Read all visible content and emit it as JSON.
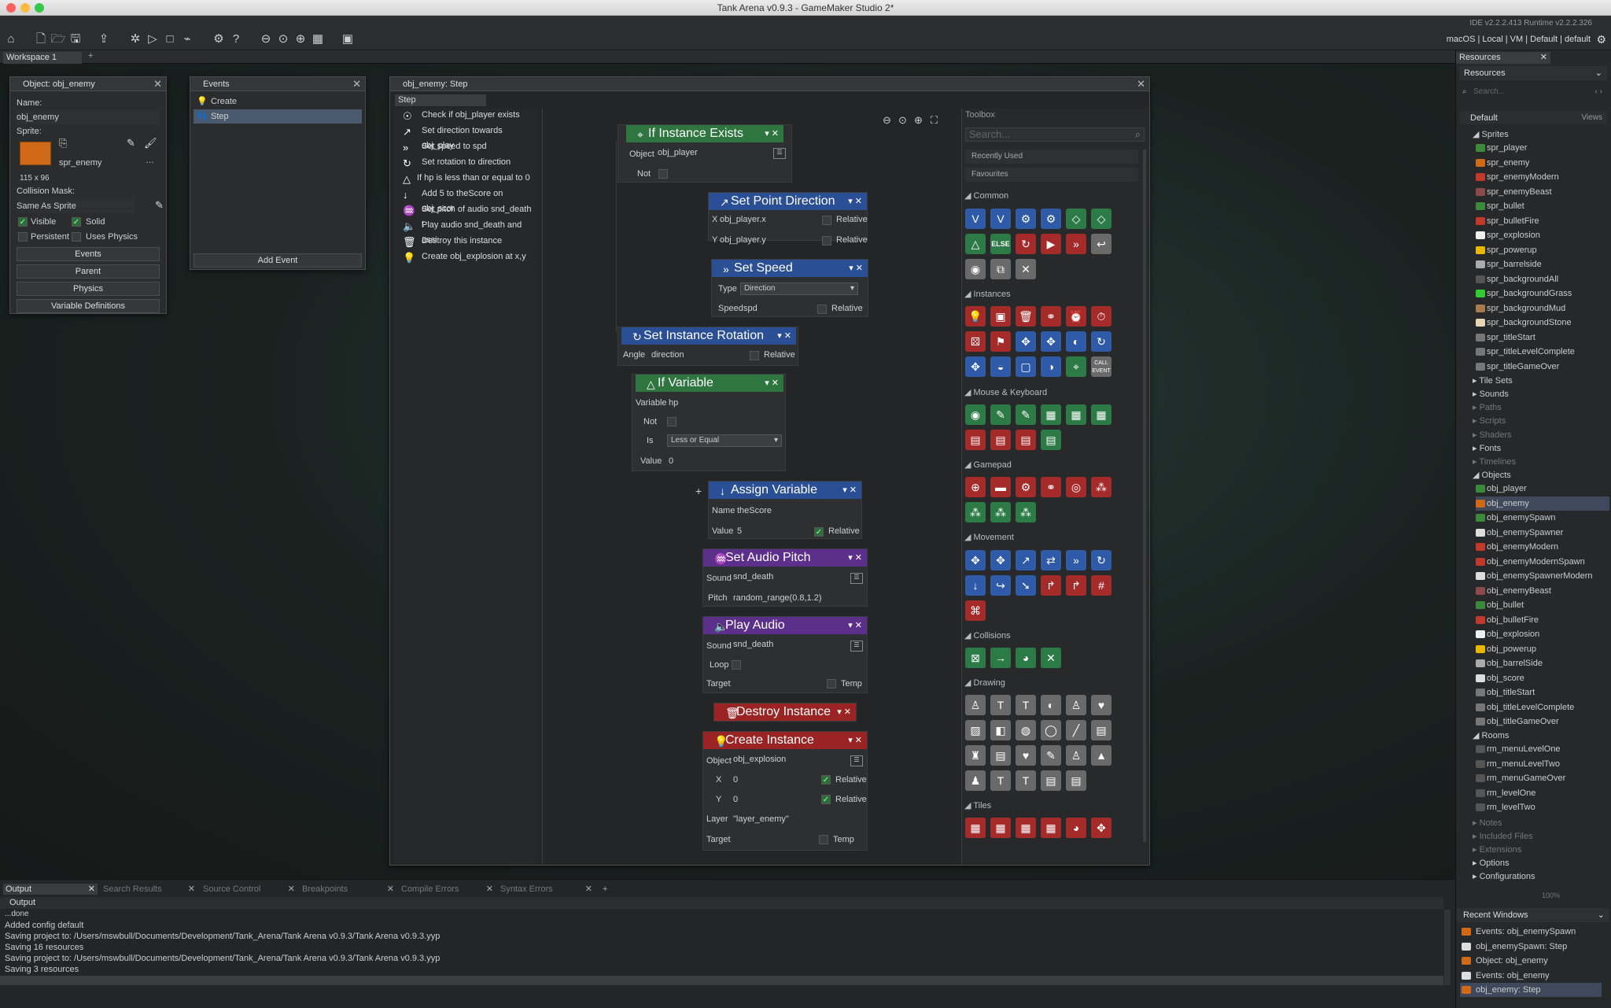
{
  "window_title": "Tank Arena v0.9.3 - GameMaker Studio 2*",
  "ide_version": "IDE v2.2.2.413  Runtime v2.2.2.326",
  "target_info": "macOS | Local | VM | Default | default",
  "workspace_tab": "Workspace 1",
  "workspace_add": "+",
  "object_panel": {
    "title": "Object: obj_enemy",
    "name_label": "Name:",
    "name_value": "obj_enemy",
    "sprite_label": "Sprite:",
    "sprite_name": "spr_enemy",
    "sprite_size": "115 x 96",
    "collision_label": "Collision Mask:",
    "collision_value": "Same As Sprite",
    "visible": "Visible",
    "solid": "Solid",
    "persistent": "Persistent",
    "uses_physics": "Uses Physics",
    "events_btn": "Events",
    "parent_btn": "Parent",
    "physics_btn": "Physics",
    "vardefs_btn": "Variable Definitions"
  },
  "events_panel": {
    "title": "Events",
    "items": [
      "Create",
      "Step"
    ],
    "add_event": "Add Event"
  },
  "editor": {
    "title": "obj_enemy: Step",
    "tab": "Step",
    "step_list": [
      "Check if obj_player exists",
      "Set direction towards obj_play",
      "Set speed to spd",
      "Set rotation to direction",
      "If hp is less than or equal to 0",
      "Add 5 to theScore on obj_scor",
      "Set pitch of audio snd_death t",
      "Play audio snd_death and assi",
      "Destroy this instance",
      "Create obj_explosion at x,y"
    ]
  },
  "blocks": {
    "if_instance_exists": {
      "title": "If Instance Exists",
      "object_label": "Object",
      "object_value": "obj_player",
      "not": "Not"
    },
    "set_point_direction": {
      "title": "Set Point Direction",
      "x_label": "X",
      "x_value": "obj_player.x",
      "y_label": "Y",
      "y_value": "obj_player.y",
      "relative": "Relative"
    },
    "set_speed": {
      "title": "Set Speed",
      "type_label": "Type",
      "type_value": "Direction",
      "speed_label": "Speed",
      "speed_value": "spd",
      "relative": "Relative"
    },
    "set_instance_rotation": {
      "title": "Set Instance Rotation",
      "angle_label": "Angle",
      "angle_value": "direction",
      "relative": "Relative"
    },
    "if_variable": {
      "title": "If Variable",
      "variable_label": "Variable",
      "variable_value": "hp",
      "not": "Not",
      "is_label": "Is",
      "is_value": "Less or Equal",
      "value_label": "Value",
      "value_value": "0"
    },
    "assign_variable": {
      "title": "Assign Variable",
      "name_label": "Name",
      "name_value": "theScore",
      "value_label": "Value",
      "value_value": "5",
      "relative": "Relative"
    },
    "set_audio_pitch": {
      "title": "Set Audio Pitch",
      "sound_label": "Sound",
      "sound_value": "snd_death",
      "pitch_label": "Pitch",
      "pitch_value": "random_range(0.8,1.2)"
    },
    "play_audio": {
      "title": "Play Audio",
      "sound_label": "Sound",
      "sound_value": "snd_death",
      "loop": "Loop",
      "target_label": "Target",
      "temp": "Temp"
    },
    "destroy_instance": {
      "title": "Destroy Instance"
    },
    "create_instance": {
      "title": "Create Instance",
      "object_label": "Object",
      "object_value": "obj_explosion",
      "x_label": "X",
      "x_value": "0",
      "y_label": "Y",
      "y_value": "0",
      "relative": "Relative",
      "layer_label": "Layer",
      "layer_value": "\"layer_enemy\"",
      "target_label": "Target",
      "temp": "Temp"
    }
  },
  "toolbox": {
    "title": "Toolbox",
    "search_placeholder": "Search...",
    "recently_used": "Recently Used",
    "favourites": "Favourites",
    "sections": [
      "Common",
      "Instances",
      "Mouse & Keyboard",
      "Gamepad",
      "Movement",
      "Collisions",
      "Drawing",
      "Tiles"
    ],
    "else_label": "ELSE"
  },
  "resources": {
    "title": "Resources",
    "dropdown": "Resources",
    "search_placeholder": "Search...",
    "group": "Default",
    "views": "Views",
    "categories": {
      "sprites": "Sprites",
      "tilesets": "Tile Sets",
      "sounds": "Sounds",
      "paths": "Paths",
      "scripts": "Scripts",
      "shaders": "Shaders",
      "fonts": "Fonts",
      "timelines": "Timelines",
      "objects": "Objects",
      "rooms": "Rooms",
      "notes": "Notes",
      "included": "Included Files",
      "extensions": "Extensions",
      "options": "Options",
      "configurations": "Configurations"
    },
    "sprites": [
      "spr_player",
      "spr_enemy",
      "spr_enemyModern",
      "spr_enemyBeast",
      "spr_bullet",
      "spr_bulletFire",
      "spr_explosion",
      "spr_powerup",
      "spr_barrelside",
      "spr_backgroundAll",
      "spr_backgroundGrass",
      "spr_backgroundMud",
      "spr_backgroundStone",
      "spr_titleStart",
      "spr_titleLevelComplete",
      "spr_titleGameOver"
    ],
    "objects": [
      "obj_player",
      "obj_enemy",
      "obj_enemySpawn",
      "obj_enemySpawner",
      "obj_enemyModern",
      "obj_enemyModernSpawn",
      "obj_enemySpawnerModern",
      "obj_enemyBeast",
      "obj_bullet",
      "obj_bulletFire",
      "obj_explosion",
      "obj_powerup",
      "obj_barrelSide",
      "obj_score",
      "obj_titleStart",
      "obj_titleLevelComplete",
      "obj_titleGameOver"
    ],
    "rooms": [
      "rm_menuLevelOne",
      "rm_menuLevelTwo",
      "rm_menuGameOver",
      "rm_levelOne",
      "rm_levelTwo"
    ],
    "zoom": "100%"
  },
  "recent_windows": {
    "title": "Recent Windows",
    "items": [
      "Events: obj_enemySpawn",
      "obj_enemySpawn: Step",
      "Object: obj_enemy",
      "Events: obj_enemy",
      "obj_enemy: Step"
    ]
  },
  "output": {
    "tabs": [
      "Output",
      "Search Results",
      "Source Control",
      "Breakpoints",
      "Compile Errors",
      "Syntax Errors"
    ],
    "header": "Output",
    "lines": [
      "...done",
      "Added config default",
      "Saving project to: /Users/mswbull/Documents/Development/Tank_Arena/Tank Arena v0.9.3/Tank Arena v0.9.3.yyp",
      "Saving 16 resources",
      "Saving project to: /Users/mswbull/Documents/Development/Tank_Arena/Tank Arena v0.9.3/Tank Arena v0.9.3.yyp",
      "Saving 3 resources"
    ]
  },
  "colors": {
    "accent_green": "#2e7540",
    "accent_blue": "#2a4f95",
    "accent_violet": "#5c2f8a",
    "accent_red": "#9a2424"
  }
}
